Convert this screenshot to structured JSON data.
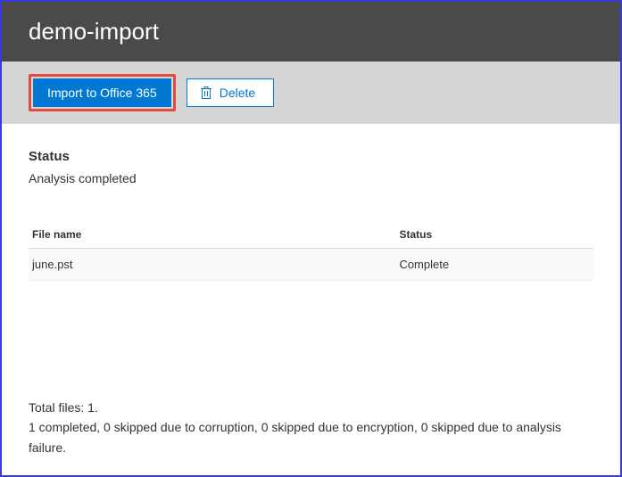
{
  "header": {
    "title": "demo-import"
  },
  "toolbar": {
    "import_label": "Import to Office 365",
    "delete_label": "Delete"
  },
  "status": {
    "heading": "Status",
    "text": "Analysis completed"
  },
  "table": {
    "columns": {
      "filename": "File name",
      "status": "Status"
    },
    "rows": [
      {
        "filename": "june.pst",
        "status": "Complete"
      }
    ]
  },
  "summary": {
    "line1": "Total files: 1.",
    "line2": "1 completed, 0 skipped due to corruption, 0 skipped due to encryption, 0 skipped due to analysis failure."
  }
}
